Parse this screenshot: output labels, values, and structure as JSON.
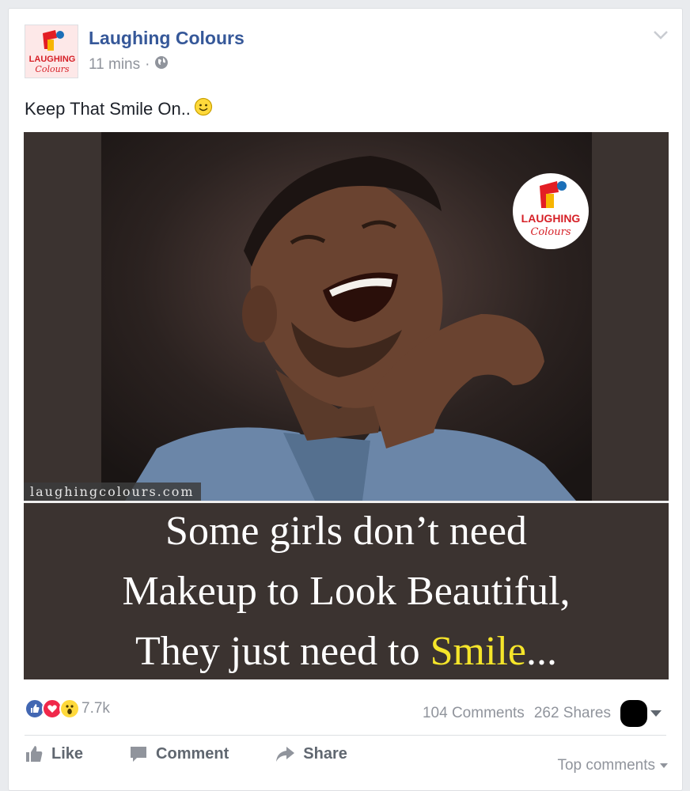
{
  "post": {
    "page_name": "Laughing Colours",
    "time": "11 mins",
    "time_separator": "·",
    "privacy_icon": "globe-icon",
    "text": "Keep That Smile On..",
    "emoji": "smiley-emoji",
    "logo_text_line1": "LAUGHING",
    "logo_text_line2": "Colours"
  },
  "image": {
    "watermark": "laughingcolours.com",
    "caption_line1": "Some girls don’t need",
    "caption_line2": "Makeup to Look Beautiful,",
    "caption_line3_prefix": "They just need to ",
    "caption_line3_highlight": "Smile",
    "caption_line3_suffix": "...",
    "highlight_color": "#f5e52a"
  },
  "reactions": {
    "icons": [
      "like-reaction-icon",
      "love-reaction-icon",
      "wow-reaction-icon"
    ],
    "count": "7.7k"
  },
  "stats": {
    "comments": "104 Comments",
    "shares": "262 Shares"
  },
  "actions": {
    "like": "Like",
    "comment": "Comment",
    "share": "Share",
    "top_comments": "Top comments"
  },
  "colors": {
    "link_blue": "#365899",
    "meta_gray": "#90949c",
    "like_blue": "#4267b2",
    "love_red": "#f0284a"
  }
}
